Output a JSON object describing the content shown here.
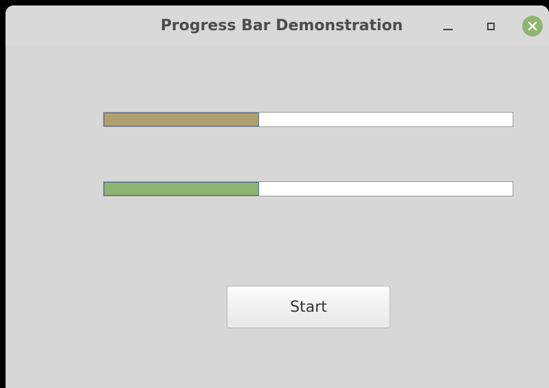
{
  "window": {
    "title": "Progress Bar Demonstration"
  },
  "progress_bars": [
    {
      "value_fraction": 0.38,
      "fill_color": "#b1a06f"
    },
    {
      "value_fraction": 0.38,
      "fill_color": "#8fb370"
    }
  ],
  "start_button": {
    "label": "Start"
  },
  "colors": {
    "window_background": "#d7d7d7",
    "close_button": "#8fb56f"
  },
  "icons": {
    "minimize": "minimize-icon",
    "maximize": "maximize-icon",
    "close": "close-icon"
  }
}
